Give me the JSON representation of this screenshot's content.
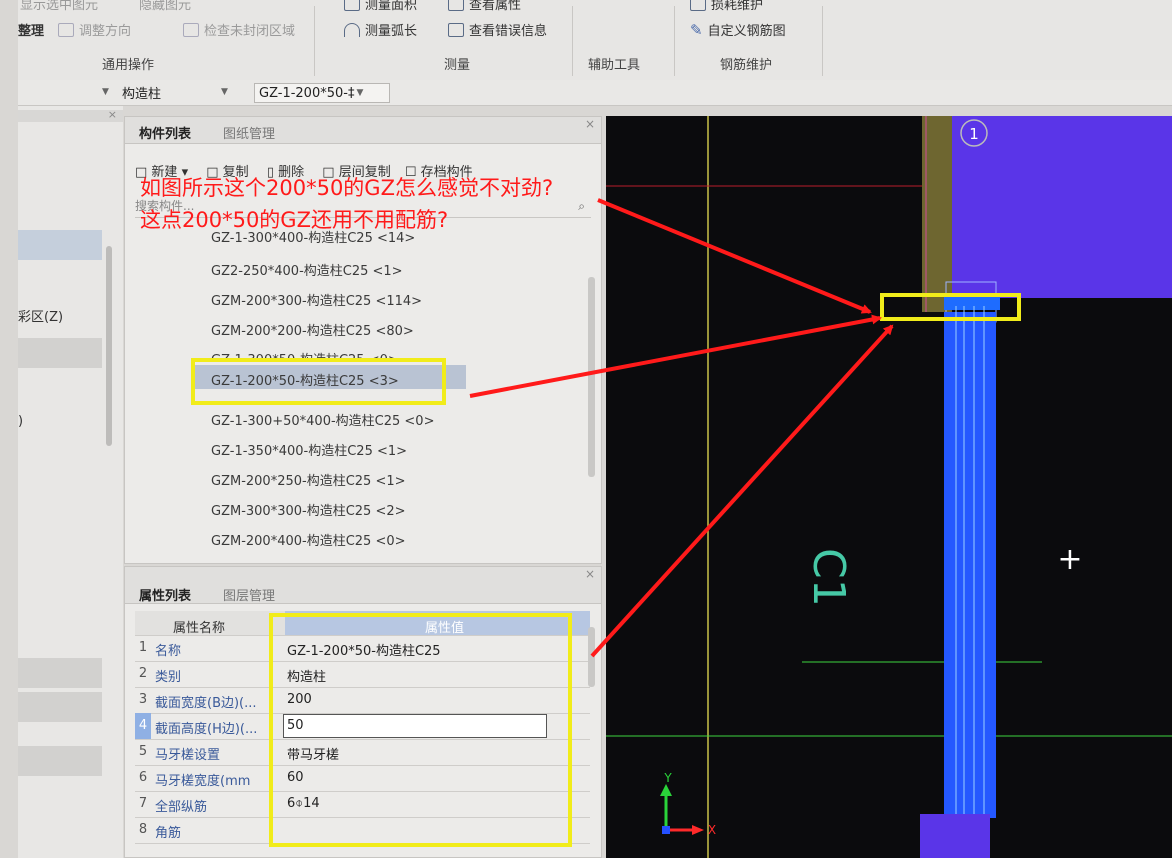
{
  "ribbon": {
    "top_items": [
      "显示选中图元",
      "隐藏图元",
      "测量面积",
      "查看属性",
      "损耗维护"
    ],
    "left_cut_label": "整理",
    "adjust_direction": "调整方向",
    "check_closed": "检查未封闭区域",
    "measure_arc": "测量弧长",
    "view_errors": "查看错误信息",
    "custom_rebar": "自定义钢筋图",
    "groups": {
      "general": "通用操作",
      "measure": "测量",
      "aux": "辅助工具",
      "rebar": "钢筋维护"
    }
  },
  "toolbar2": {
    "category": "构造柱",
    "component": "GZ-1-200*50-‡"
  },
  "leftpanel": {
    "item_z": "彩区(Z)",
    "item_paren": ")"
  },
  "component_panel": {
    "tabs": [
      "构件列表",
      "图纸管理"
    ],
    "actions": [
      "新建",
      "复制",
      "删除",
      "层间复制",
      "存档构件"
    ],
    "search_placeholder": "搜索构件...",
    "items": [
      "GZ-1-300*400-构造柱C25 <14>",
      "GZ2-250*400-构造柱C25 <1>",
      "GZM-200*300-构造柱C25 <114>",
      "GZM-200*200-构造柱C25 <80>",
      "GZ-1-300*50-构造柱C25 <0>",
      "GZ-1-200*50-构造柱C25 <3>",
      "GZ-1-300+50*400-构造柱C25 <0>",
      "GZ-1-350*400-构造柱C25 <1>",
      "GZM-200*250-构造柱C25 <1>",
      "GZM-300*300-构造柱C25 <2>",
      "GZM-200*400-构造柱C25 <0>"
    ]
  },
  "property_panel": {
    "tabs": [
      "属性列表",
      "图层管理"
    ],
    "header_name": "属性名称",
    "header_value": "属性值",
    "rows": [
      {
        "num": "1",
        "name": "名称",
        "value": "GZ-1-200*50-构造柱C25"
      },
      {
        "num": "2",
        "name": "类别",
        "value": "构造柱"
      },
      {
        "num": "3",
        "name": "截面宽度(B边)(...",
        "value": "200"
      },
      {
        "num": "4",
        "name": "截面高度(H边)(...",
        "value": "50"
      },
      {
        "num": "5",
        "name": "马牙槎设置",
        "value": "带马牙槎"
      },
      {
        "num": "6",
        "name": "马牙槎宽度(mm",
        "value": "60"
      },
      {
        "num": "7",
        "name": "全部纵筋",
        "value": "6⌽14"
      },
      {
        "num": "8",
        "name": "角筋",
        "value": ""
      }
    ]
  },
  "annotation": {
    "line1": "如图所示这个200*50的GZ怎么感觉不对劲?",
    "line2": "这点200*50的GZ还用不用配筋?"
  },
  "cad": {
    "axis_marker": "1",
    "axis_x": "X",
    "axis_y": "Y",
    "cursor": "+",
    "label": "C1"
  },
  "colors": {
    "annotation_red": "#ff1a1a",
    "highlight_yellow": "#f1ec1a",
    "column_purple": "#5a35e8",
    "column_blue": "#2255ff",
    "cad_bg": "#0b0b0d"
  }
}
